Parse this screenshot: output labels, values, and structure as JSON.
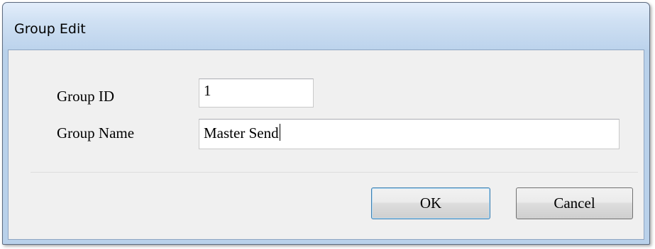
{
  "dialog": {
    "title": "Group Edit"
  },
  "form": {
    "group_id_label": "Group ID",
    "group_id_value": "1",
    "group_name_label": "Group Name",
    "group_name_value": "Master Send"
  },
  "buttons": {
    "ok_label": "OK",
    "cancel_label": "Cancel"
  }
}
